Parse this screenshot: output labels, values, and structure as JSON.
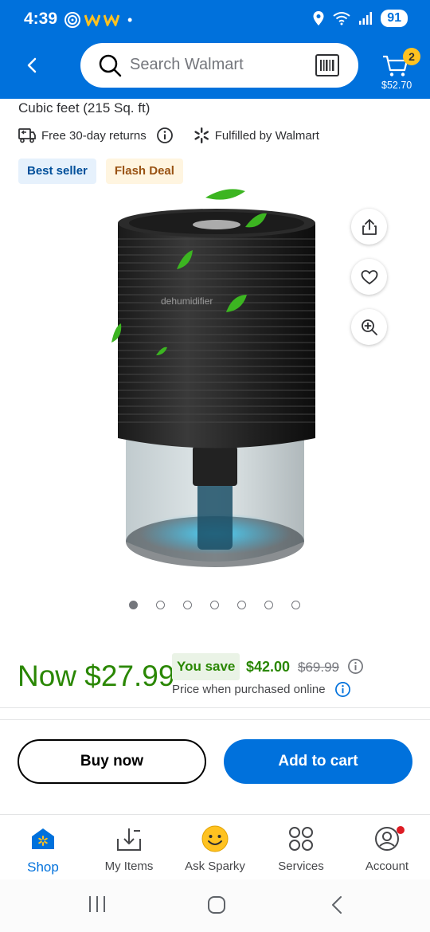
{
  "status_bar": {
    "time": "4:39",
    "battery": "91",
    "dot": "•"
  },
  "header": {
    "search_placeholder": "Search Walmart",
    "cart_count": "2",
    "cart_total": "$52.70"
  },
  "product": {
    "subtitle": "Cubic feet (215 Sq. ft)",
    "returns": "Free 30-day returns",
    "fulfilled": "Fulfilled by Walmart",
    "badges": [
      "Best seller",
      "Flash Deal"
    ],
    "image_brand_text": "dehumidifier",
    "image_count": 7,
    "active_image": 1
  },
  "price": {
    "now": "Now $27.99",
    "you_save_label": "You save",
    "save_amount": "$42.00",
    "was_price": "$69.99",
    "note": "Price when purchased online"
  },
  "actions": {
    "buy_now": "Buy now",
    "add_to_cart": "Add to cart"
  },
  "bottom_nav": [
    {
      "label": "Shop",
      "icon": "shop-icon",
      "active": true
    },
    {
      "label": "My Items",
      "icon": "my-items-icon",
      "active": false
    },
    {
      "label": "Ask Sparky",
      "icon": "sparky-icon",
      "active": false
    },
    {
      "label": "Services",
      "icon": "services-icon",
      "active": false
    },
    {
      "label": "Account",
      "icon": "account-icon",
      "active": false
    }
  ],
  "colors": {
    "brand_blue": "#0071dc",
    "price_green": "#2a8703",
    "spark_yellow": "#ffc220"
  }
}
